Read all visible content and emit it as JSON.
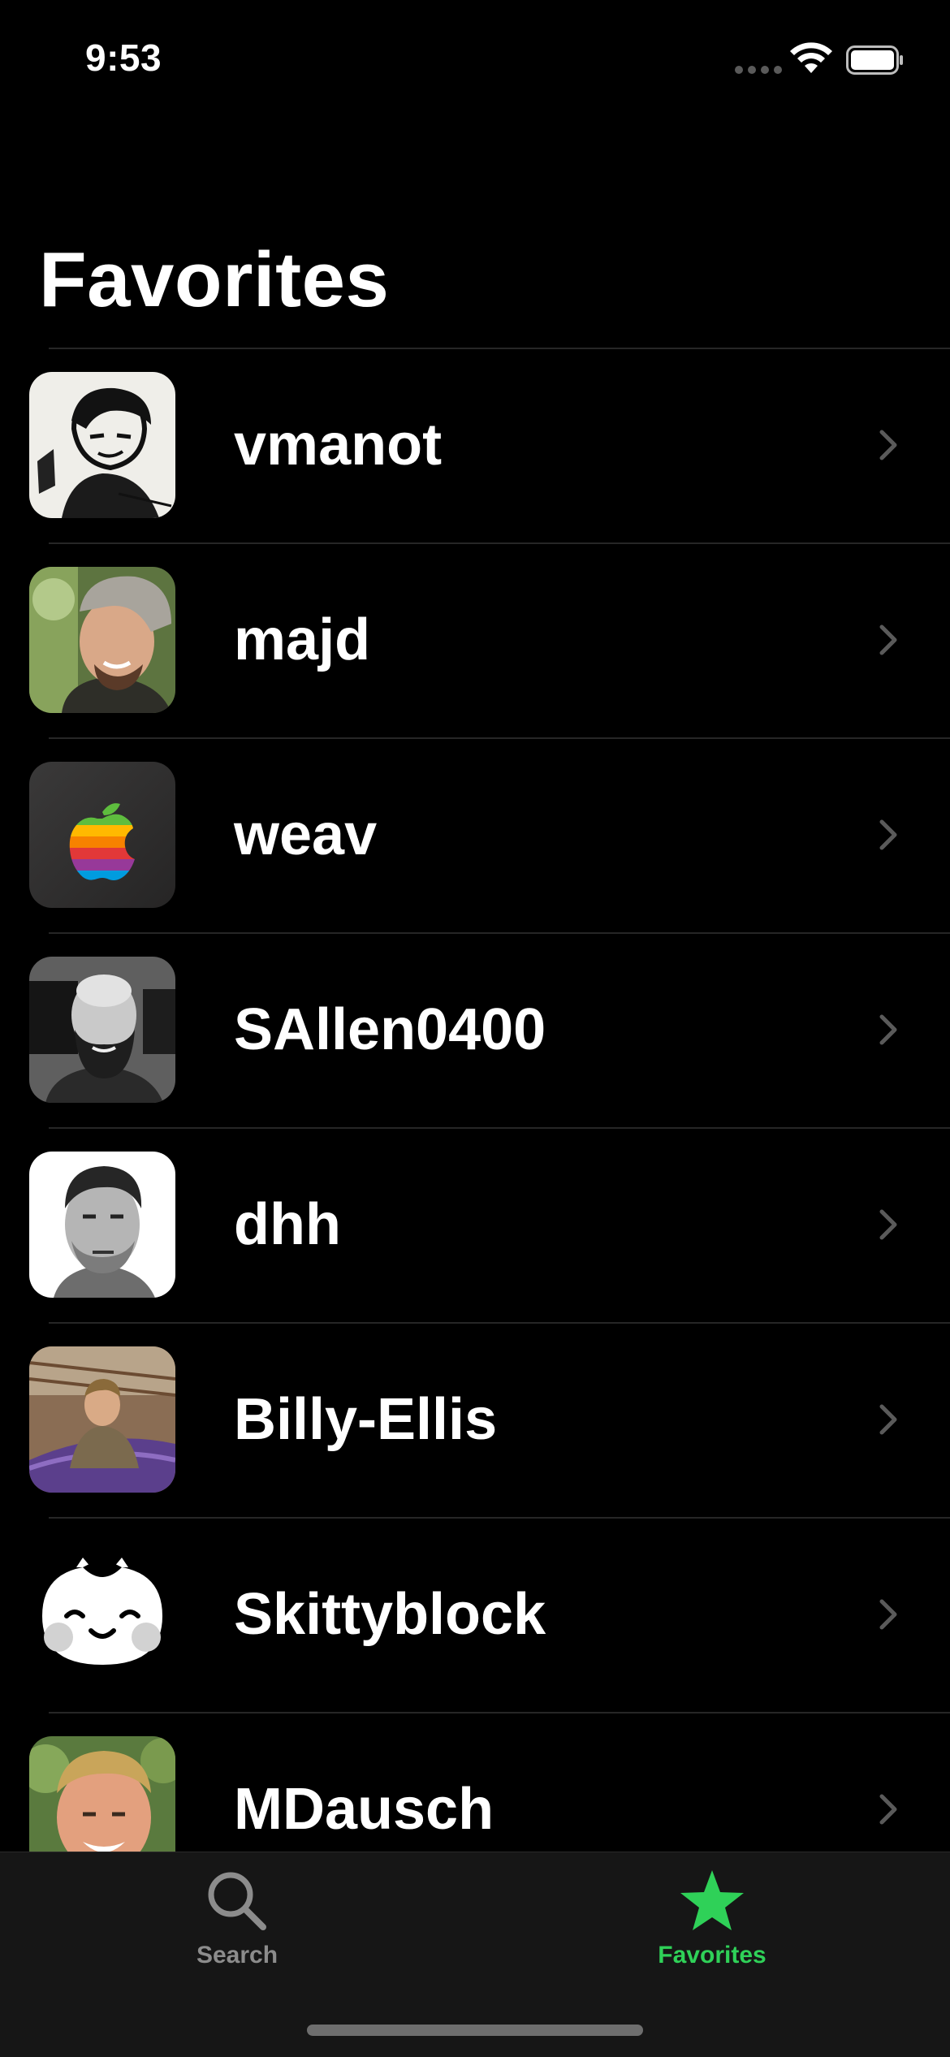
{
  "status_bar": {
    "time": "9:53"
  },
  "title": "Favorites",
  "favorites": [
    {
      "name": "vmanot",
      "avatar": "sketch-portrait"
    },
    {
      "name": "majd",
      "avatar": "photo-portrait-cap"
    },
    {
      "name": "weav",
      "avatar": "apple-logo"
    },
    {
      "name": "SAllen0400",
      "avatar": "photo-portrait-bald"
    },
    {
      "name": "dhh",
      "avatar": "photo-portrait-bw"
    },
    {
      "name": "Billy-Ellis",
      "avatar": "photo-portrait-hammock"
    },
    {
      "name": "Skittyblock",
      "avatar": "cat-face"
    },
    {
      "name": "MDausch",
      "avatar": "photo-portrait-smile"
    }
  ],
  "tab_bar": {
    "tabs": [
      {
        "label": "Search",
        "icon": "search-icon",
        "selected": false
      },
      {
        "label": "Favorites",
        "icon": "star-icon",
        "selected": true
      }
    ]
  },
  "colors": {
    "background": "#000000",
    "accent": "#2fd158",
    "tab_inactive": "#8c8c8c",
    "chevron": "#5a5a5a"
  }
}
